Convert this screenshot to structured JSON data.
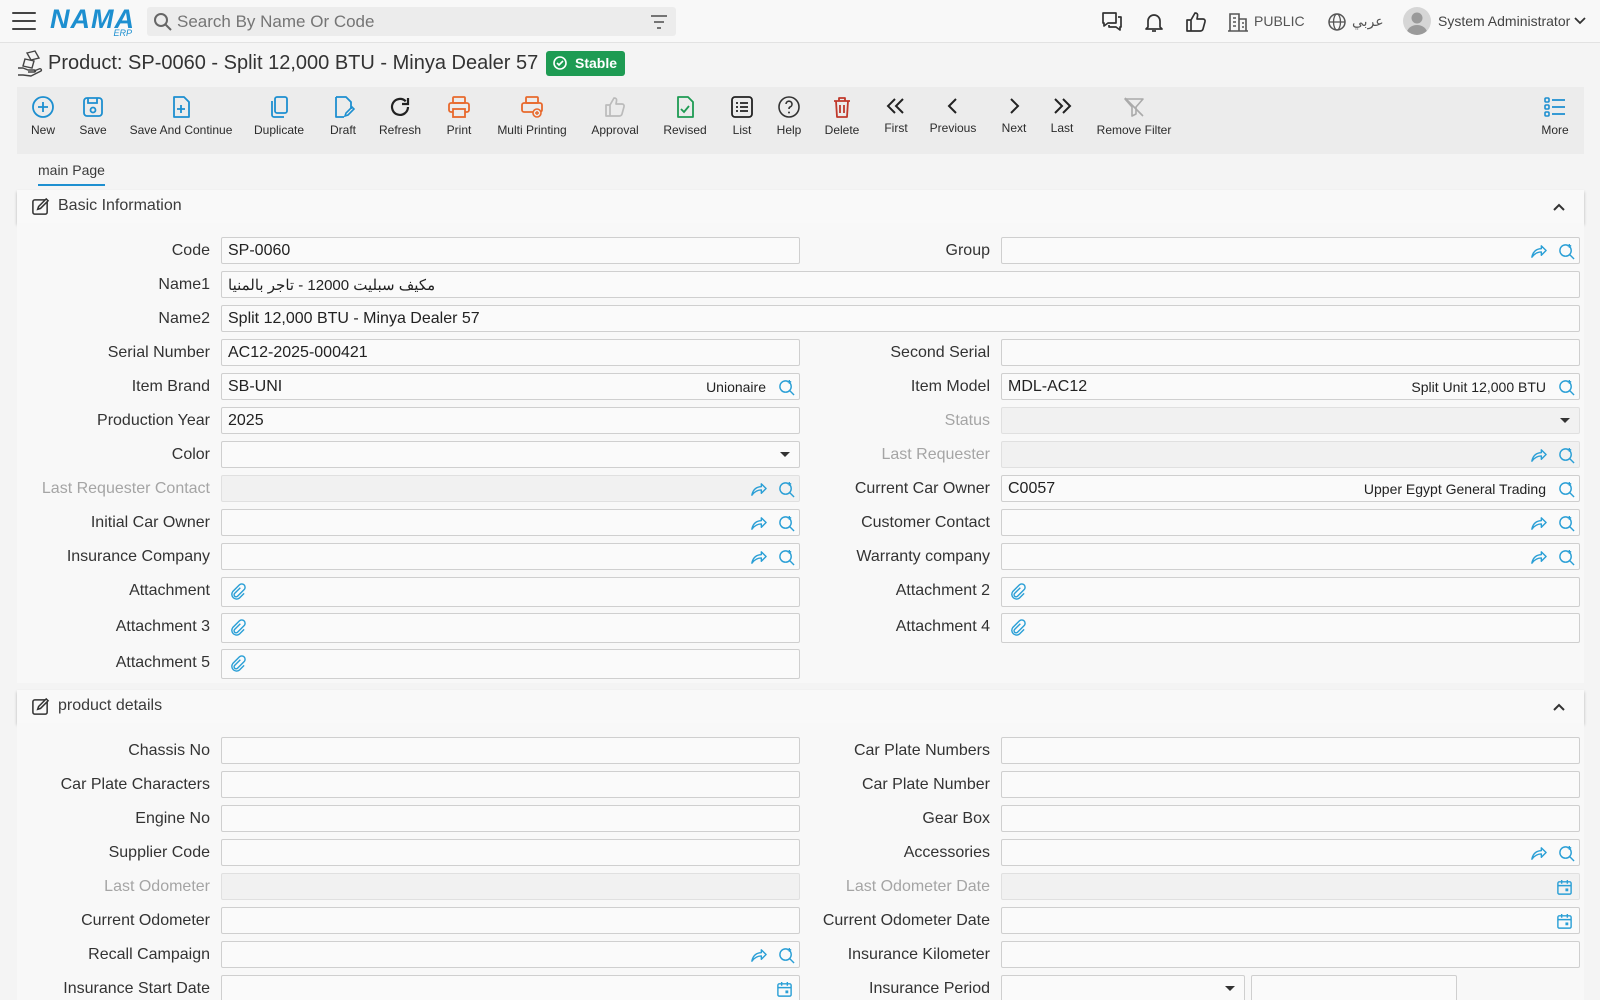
{
  "app": {
    "logo_text": "NAMA",
    "logo_sub": "ERP"
  },
  "topbar": {
    "search_placeholder": "Search By Name Or Code",
    "company": "PUBLIC",
    "language": "عربي",
    "user": "System Administrator"
  },
  "page": {
    "title": "Product: SP-0060 - Split 12,000 BTU - Minya Dealer 57",
    "status": "Stable"
  },
  "toolbar": {
    "new": "New",
    "save": "Save",
    "save_continue": "Save And Continue",
    "duplicate": "Duplicate",
    "draft": "Draft",
    "refresh": "Refresh",
    "print": "Print",
    "multi_printing": "Multi Printing",
    "approval": "Approval",
    "revised": "Revised",
    "list": "List",
    "help": "Help",
    "delete": "Delete",
    "first": "First",
    "previous": "Previous",
    "next": "Next",
    "last": "Last",
    "remove_filter": "Remove Filter",
    "more": "More"
  },
  "tabs": {
    "main": "main Page"
  },
  "sections": {
    "basic": "Basic Information",
    "details": "product details"
  },
  "basic": {
    "code": {
      "label": "Code",
      "value": "SP-0060"
    },
    "group": {
      "label": "Group",
      "value": ""
    },
    "name1": {
      "label": "Name1",
      "value": "مكيف سبليت 12000 - تاجر بالمنيا"
    },
    "name2": {
      "label": "Name2",
      "value": "Split 12,000 BTU - Minya Dealer 57"
    },
    "serial": {
      "label": "Serial Number",
      "value": "AC12-2025-000421"
    },
    "second_serial": {
      "label": "Second Serial",
      "value": ""
    },
    "brand": {
      "label": "Item Brand",
      "value": "SB-UNI",
      "desc": "Unionaire"
    },
    "model": {
      "label": "Item Model",
      "value": "MDL-AC12",
      "desc": "Split Unit 12,000 BTU"
    },
    "production_year": {
      "label": "Production Year",
      "value": "2025"
    },
    "status": {
      "label": "Status",
      "value": ""
    },
    "color": {
      "label": "Color",
      "value": ""
    },
    "last_requester": {
      "label": "Last Requester",
      "value": ""
    },
    "last_requester_contact": {
      "label": "Last Requester Contact",
      "value": ""
    },
    "current_owner": {
      "label": "Current Car Owner",
      "value": "C0057",
      "desc": "Upper Egypt General Trading"
    },
    "initial_owner": {
      "label": "Initial Car Owner",
      "value": ""
    },
    "customer_contact": {
      "label": "Customer Contact",
      "value": ""
    },
    "insurance_company": {
      "label": "Insurance Company",
      "value": ""
    },
    "warranty_company": {
      "label": "Warranty company",
      "value": ""
    },
    "attachment1": {
      "label": "Attachment"
    },
    "attachment2": {
      "label": "Attachment 2"
    },
    "attachment3": {
      "label": "Attachment 3"
    },
    "attachment4": {
      "label": "Attachment 4"
    },
    "attachment5": {
      "label": "Attachment 5"
    }
  },
  "details": {
    "chassis": {
      "label": "Chassis No",
      "value": ""
    },
    "plate_numbers": {
      "label": "Car Plate Numbers",
      "value": ""
    },
    "plate_chars": {
      "label": "Car Plate Characters",
      "value": ""
    },
    "plate_number": {
      "label": "Car Plate Number",
      "value": ""
    },
    "engine": {
      "label": "Engine No",
      "value": ""
    },
    "gear_box": {
      "label": "Gear Box",
      "value": ""
    },
    "supplier_code": {
      "label": "Supplier Code",
      "value": ""
    },
    "accessories": {
      "label": "Accessories",
      "value": ""
    },
    "last_odometer": {
      "label": "Last Odometer",
      "value": ""
    },
    "last_odometer_date": {
      "label": "Last Odometer Date",
      "value": ""
    },
    "current_odometer": {
      "label": "Current Odometer",
      "value": ""
    },
    "current_odometer_date": {
      "label": "Current Odometer Date",
      "value": ""
    },
    "recall_campaign": {
      "label": "Recall Campaign",
      "value": ""
    },
    "insurance_km": {
      "label": "Insurance Kilometer",
      "value": ""
    },
    "insurance_start": {
      "label": "Insurance Start Date",
      "value": ""
    },
    "insurance_period": {
      "label": "Insurance Period",
      "value": ""
    }
  },
  "colors": {
    "accent": "#1d8fd0",
    "stable": "#1e9b53",
    "print": "#e8692d",
    "delete": "#c0392b",
    "revised": "#1e9b53",
    "lookup": "#2a9fd6"
  }
}
